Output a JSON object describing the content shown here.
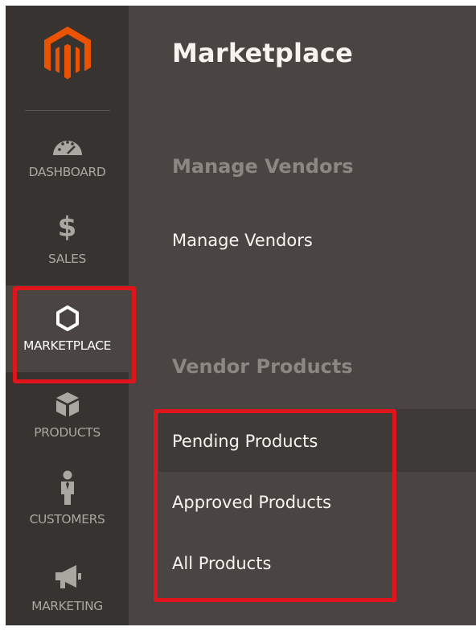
{
  "sidebar": {
    "logo_icon": "magento-logo-icon",
    "items": [
      {
        "label": "DASHBOARD",
        "icon": "speedometer-icon"
      },
      {
        "label": "SALES",
        "icon": "dollar-icon"
      },
      {
        "label": "MARKETPLACE",
        "icon": "hexagon-icon",
        "active": true
      },
      {
        "label": "PRODUCTS",
        "icon": "cube-icon"
      },
      {
        "label": "CUSTOMERS",
        "icon": "person-icon"
      },
      {
        "label": "MARKETING",
        "icon": "megaphone-icon"
      }
    ],
    "dollar_glyph": "$"
  },
  "panel": {
    "title": "Marketplace",
    "sections": [
      {
        "title": "Manage Vendors",
        "links": [
          "Manage Vendors"
        ]
      },
      {
        "title": "Vendor Products",
        "links": [
          "Pending Products",
          "Approved Products",
          "All Products"
        ]
      }
    ]
  },
  "colors": {
    "sidebar_bg": "#373330",
    "panel_bg": "#4a4542",
    "logo_orange": "#eb5202",
    "highlight_red": "#e0141b"
  }
}
